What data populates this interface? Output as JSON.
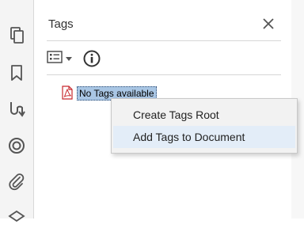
{
  "panel": {
    "title": "Tags"
  },
  "toolbar": {
    "options_icon": "options-list-icon",
    "info_icon": "info-icon"
  },
  "tree": {
    "root_label": "No Tags available"
  },
  "context_menu": {
    "items": [
      {
        "label": "Create Tags Root",
        "highlighted": false
      },
      {
        "label": "Add Tags to Document",
        "highlighted": true
      }
    ]
  },
  "left_rail": {
    "icons": [
      "pages-icon",
      "bookmark-icon",
      "content-order-icon",
      "layers-target-icon",
      "attachment-icon",
      "layers-icon"
    ]
  },
  "colors": {
    "selection": "#a9c6e4",
    "menu_highlight": "#e3edf8",
    "pdf_icon": "#c8282d"
  }
}
